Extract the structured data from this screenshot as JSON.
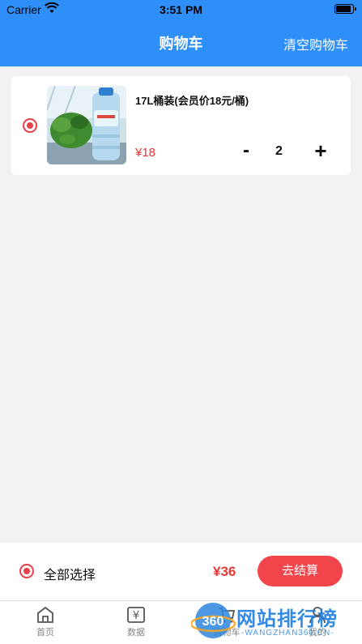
{
  "status_bar": {
    "carrier": "Carrier",
    "time": "3:51 PM"
  },
  "header": {
    "title": "购物车",
    "clear_label": "清空购物车",
    "bg_color": "#2f8ff8"
  },
  "cart": {
    "items": [
      {
        "name": "17L桶装(会员价18元/桶)",
        "price": "¥18",
        "quantity": "2",
        "minus": "-",
        "plus": "+",
        "selected": true
      }
    ]
  },
  "footer": {
    "select_all_label": "全部选择",
    "total": "¥36",
    "checkout_label": "去结算",
    "accent_color": "#f2454b"
  },
  "tabbar": {
    "tabs": [
      {
        "label": "首页",
        "icon": "home-icon"
      },
      {
        "label": "数据",
        "icon": "yen-icon"
      },
      {
        "label": "购物车",
        "icon": "cart-icon"
      },
      {
        "label": "我的",
        "icon": "user-icon"
      }
    ]
  },
  "watermark": {
    "logo": "360",
    "text": "网站排行榜",
    "sub": "-WANGZHAN360.CN-"
  }
}
